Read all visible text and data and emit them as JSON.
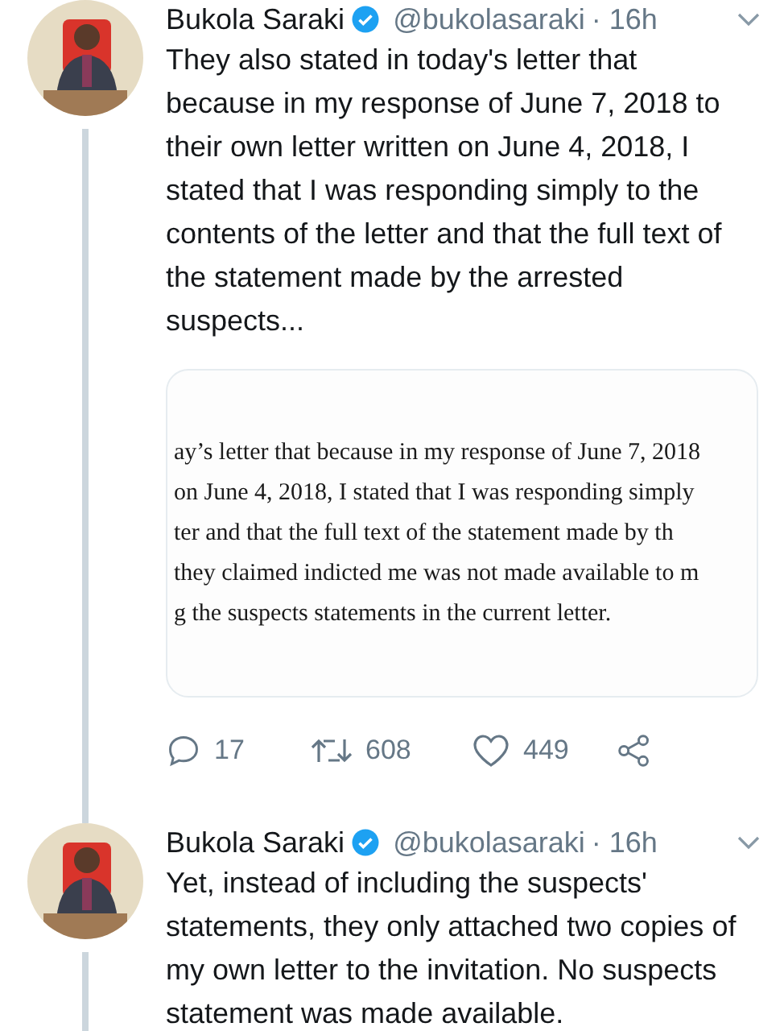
{
  "tweets": [
    {
      "name": "Bukola Saraki",
      "verified": true,
      "handle": "@bukolasaraki",
      "time": "· 16h",
      "text": "They also stated in today's letter that because in my response of June 7, 2018 to their own letter written on June 4, 2018, I stated that I was responding simply to the contents of the letter and that the full text of the statement made by the arrested suspects...",
      "document": {
        "lines": [
          "ay’s letter that because in my response of June 7, 2018",
          "on June 4, 2018, I stated that I was responding simply",
          "ter and that the full text of the statement made by th",
          "they claimed indicted me was not made available to m",
          "g the suspects statements in the current letter."
        ]
      },
      "actions": {
        "replies": "17",
        "retweets": "608",
        "likes": "449"
      }
    },
    {
      "name": "Bukola Saraki",
      "verified": true,
      "handle": "@bukolasaraki",
      "time": "· 16h",
      "text": "Yet, instead of including the suspects' statements, they only attached two copies of my own letter to the invitation. No suspects statement was made available."
    }
  ]
}
